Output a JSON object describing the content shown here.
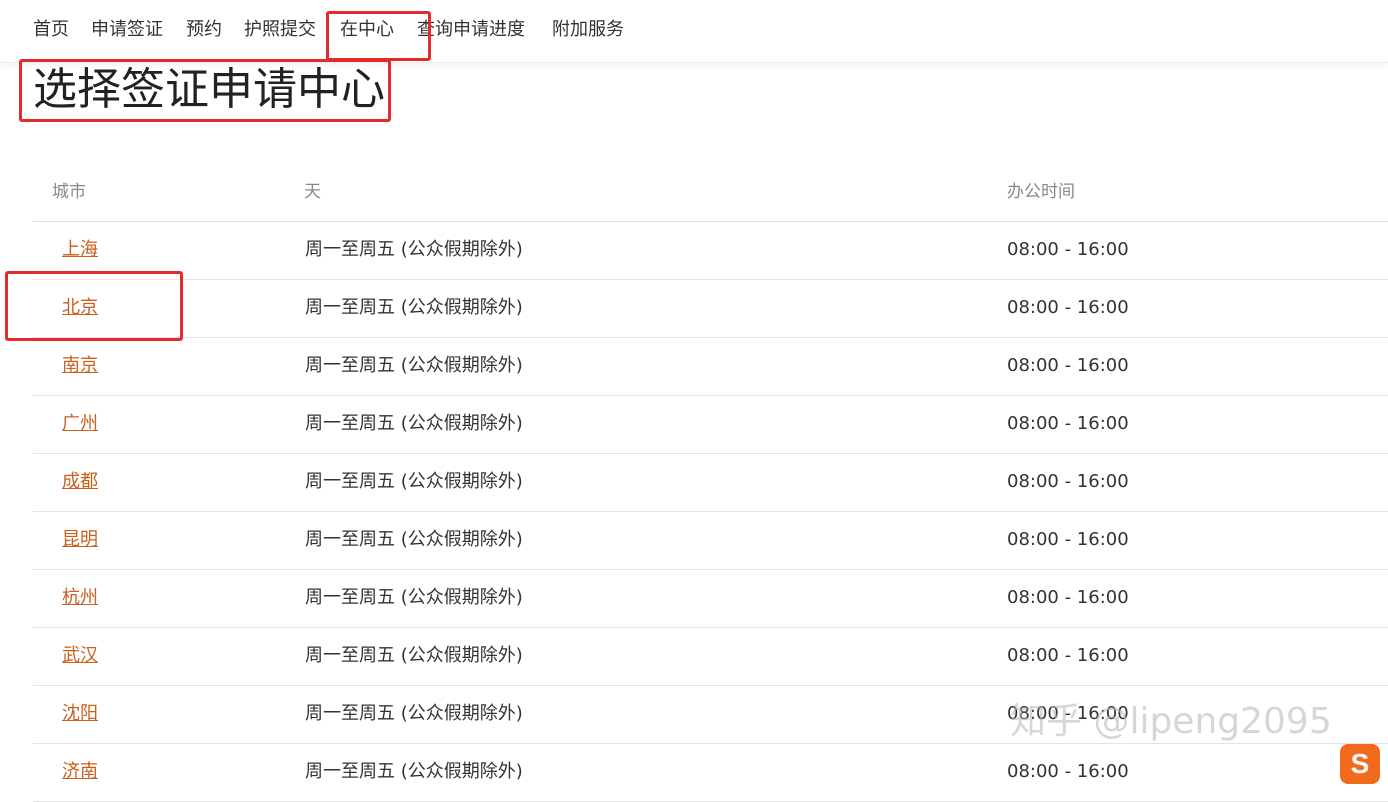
{
  "nav": [
    {
      "label": "首页"
    },
    {
      "label": "申请签证"
    },
    {
      "label": "预约"
    },
    {
      "label": "护照提交"
    },
    {
      "label": "在中心"
    },
    {
      "label": "查询申请进度"
    },
    {
      "label": "附加服务"
    }
  ],
  "page_title": "选择签证申请中心",
  "table": {
    "headers": {
      "city": "城市",
      "days": "天",
      "hours": "办公时间"
    },
    "rows": [
      {
        "city": "上海",
        "days": "周一至周五 (公众假期除外)",
        "hours": "08:00 - 16:00"
      },
      {
        "city": "北京",
        "days": "周一至周五 (公众假期除外)",
        "hours": "08:00 - 16:00"
      },
      {
        "city": "南京",
        "days": "周一至周五 (公众假期除外)",
        "hours": "08:00 - 16:00"
      },
      {
        "city": "广州",
        "days": "周一至周五 (公众假期除外)",
        "hours": "08:00 - 16:00"
      },
      {
        "city": "成都",
        "days": "周一至周五 (公众假期除外)",
        "hours": "08:00 - 16:00"
      },
      {
        "city": "昆明",
        "days": "周一至周五 (公众假期除外)",
        "hours": "08:00 - 16:00"
      },
      {
        "city": "杭州",
        "days": "周一至周五 (公众假期除外)",
        "hours": "08:00 - 16:00"
      },
      {
        "city": "武汉",
        "days": "周一至周五 (公众假期除外)",
        "hours": "08:00 - 16:00"
      },
      {
        "city": "沈阳",
        "days": "周一至周五 (公众假期除外)",
        "hours": "08:00 - 16:00"
      },
      {
        "city": "济南",
        "days": "周一至周五 (公众假期除外)",
        "hours": "08:00 - 16:00"
      }
    ]
  },
  "watermark": "知乎 @lipeng2095",
  "ime_badge": "S",
  "colors": {
    "link": "#c8601e",
    "highlight": "#e42b2b",
    "text": "#333333",
    "header_text": "#888888"
  }
}
